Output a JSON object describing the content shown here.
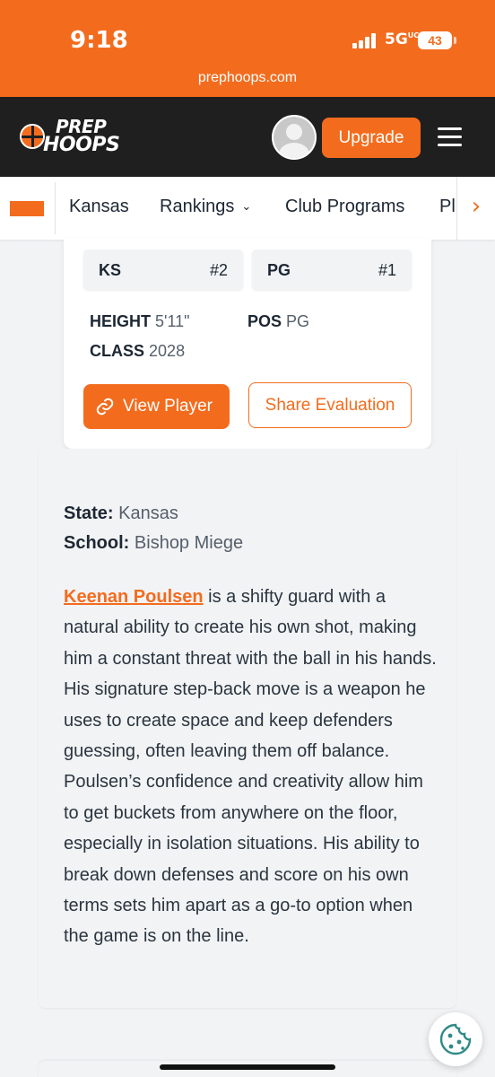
{
  "status_bar": {
    "time": "9:18",
    "network": "5G",
    "network_sub": "UC",
    "battery": "43",
    "url": "prephoops.com"
  },
  "header": {
    "logo_line1": "PREP",
    "logo_line2": "HOOPS",
    "upgrade_label": "Upgrade",
    "accent_color": "#f36c1e",
    "background_color": "#1f1f1f"
  },
  "nav": {
    "items": [
      {
        "label": "Kansas"
      },
      {
        "label": "Rankings"
      },
      {
        "label": "Club Programs"
      },
      {
        "label": "Pl"
      }
    ],
    "next_icon": "chevron-right-icon"
  },
  "player_card": {
    "state_rank": {
      "label": "KS",
      "value": "#2"
    },
    "position_rank": {
      "label": "PG",
      "value": "#1"
    },
    "height": {
      "label": "HEIGHT",
      "value": "5'11\""
    },
    "pos": {
      "label": "POS",
      "value": "PG"
    },
    "class": {
      "label": "CLASS",
      "value": "2028"
    },
    "view_player_label": "View Player",
    "share_evaluation_label": "Share Evaluation"
  },
  "article": {
    "state": {
      "label": "State:",
      "value": "Kansas"
    },
    "school": {
      "label": "School:",
      "value": "Bishop Miege"
    },
    "player_link": "Keenan Poulsen",
    "body": " is a shifty guard with a natural ability to create his own shot, making him a constant threat with the ball in his hands. His signature step-back move is a weapon he uses to create space and keep defenders guessing, often leaving them off balance. Poulsen’s confidence and creativity allow him to get buckets from anywhere on the floor, especially in isolation situations. His ability to break down defenses and score on his own terms sets him apart as a go-to option when the game is on the line."
  },
  "cookie_icon": "cookie-icon"
}
